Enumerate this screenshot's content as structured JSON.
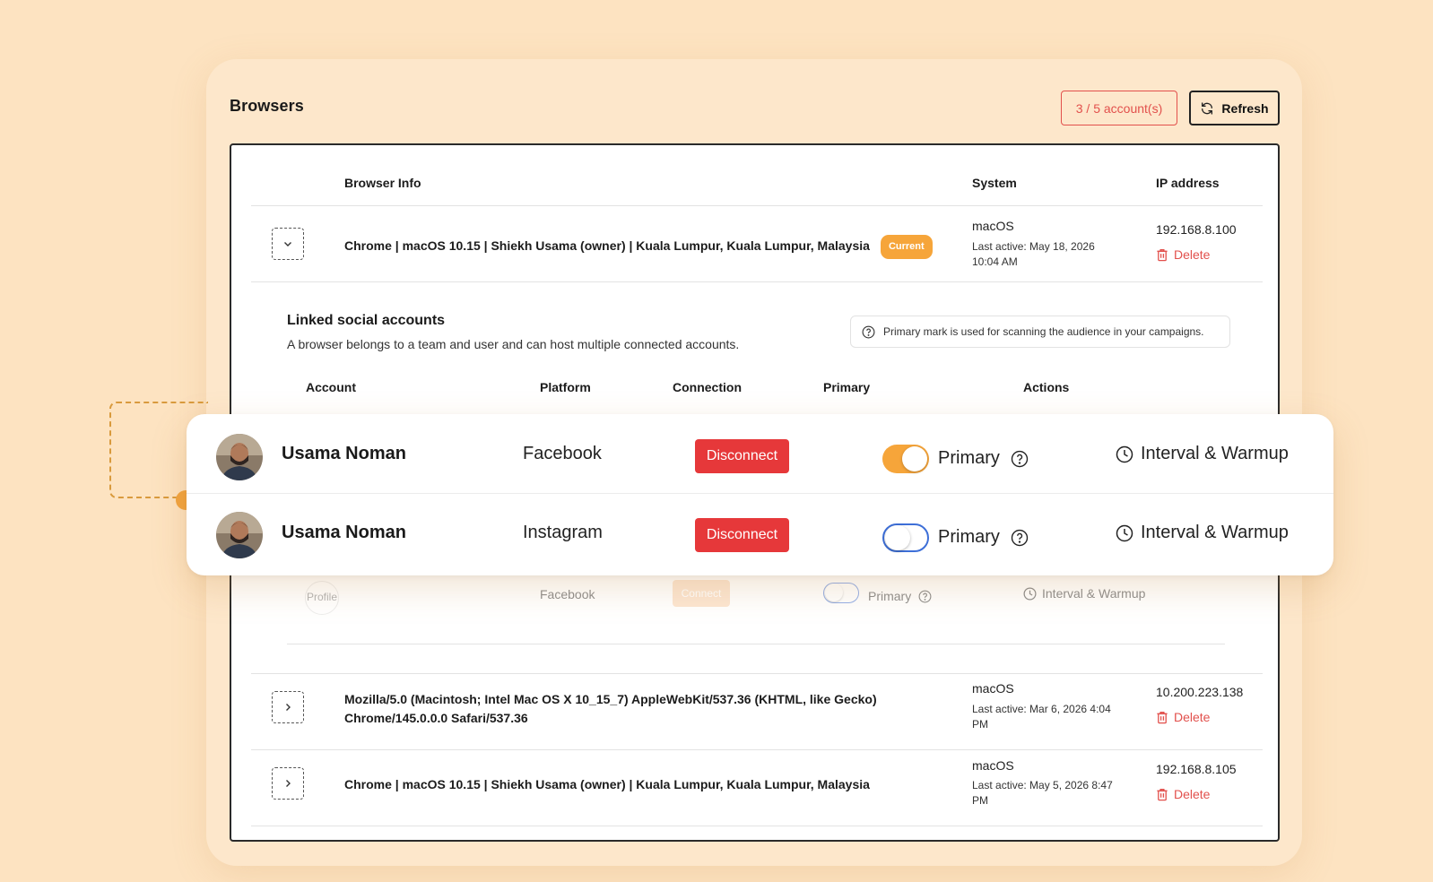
{
  "header": {
    "title": "Browsers",
    "account_count": "3 / 5 account(s)",
    "refresh_label": "Refresh"
  },
  "table": {
    "columns": {
      "browser_info": "Browser Info",
      "system": "System",
      "ip": "IP address"
    },
    "rows": [
      {
        "browser": "Chrome | macOS 10.15 | Shiekh Usama (owner) | Kuala Lumpur, Kuala Lumpur, Malaysia",
        "badge": "Current",
        "system": "macOS",
        "active_1": "Last active: May 18, 2026",
        "active_2": "10:04 AM",
        "ip": "192.168.8.100",
        "delete": "Delete"
      },
      {
        "browser_1": "Mozilla/5.0 (Macintosh; Intel Mac OS X 10_15_7) AppleWebKit/537.36 (KHTML, like Gecko)",
        "browser_2": "Chrome/145.0.0.0 Safari/537.36",
        "system": "macOS",
        "active_1": "Last active: Mar 6, 2026 4:04",
        "active_2": "PM",
        "ip": "10.200.223.138",
        "delete": "Delete"
      },
      {
        "browser": "Chrome | macOS 10.15 | Shiekh Usama (owner) | Kuala Lumpur, Kuala Lumpur, Malaysia",
        "system": "macOS",
        "active_1": "Last active: May 5, 2026 8:47",
        "active_2": "PM",
        "ip": "192.168.8.105",
        "delete": "Delete"
      }
    ]
  },
  "linked": {
    "title": "Linked social accounts",
    "subtitle": "A browser belongs to a team and user and can host multiple connected accounts.",
    "note": "Primary mark is used for scanning the audience in your campaigns.",
    "columns": {
      "account": "Account",
      "platform": "Platform",
      "connection": "Connection",
      "primary": "Primary",
      "actions": "Actions"
    },
    "accounts": [
      {
        "name": "Usama Noman",
        "platform": "Facebook",
        "connection": "Disconnect",
        "primary_label": "Primary",
        "primary": true,
        "action": "Interval & Warmup"
      },
      {
        "name": "Usama Noman",
        "platform": "Instagram",
        "connection": "Disconnect",
        "primary_label": "Primary",
        "primary": false,
        "action": "Interval & Warmup"
      }
    ],
    "ghost_row": {
      "avatar_alt": "Profile",
      "platform": "Facebook",
      "connection": "Connect",
      "primary_label": "Primary",
      "action": "Interval & Warmup"
    }
  },
  "colors": {
    "background": "#fde3c1",
    "accent_orange": "#f6a53a",
    "danger_red": "#e6383a",
    "toggle_blue": "#3d6fd8"
  }
}
